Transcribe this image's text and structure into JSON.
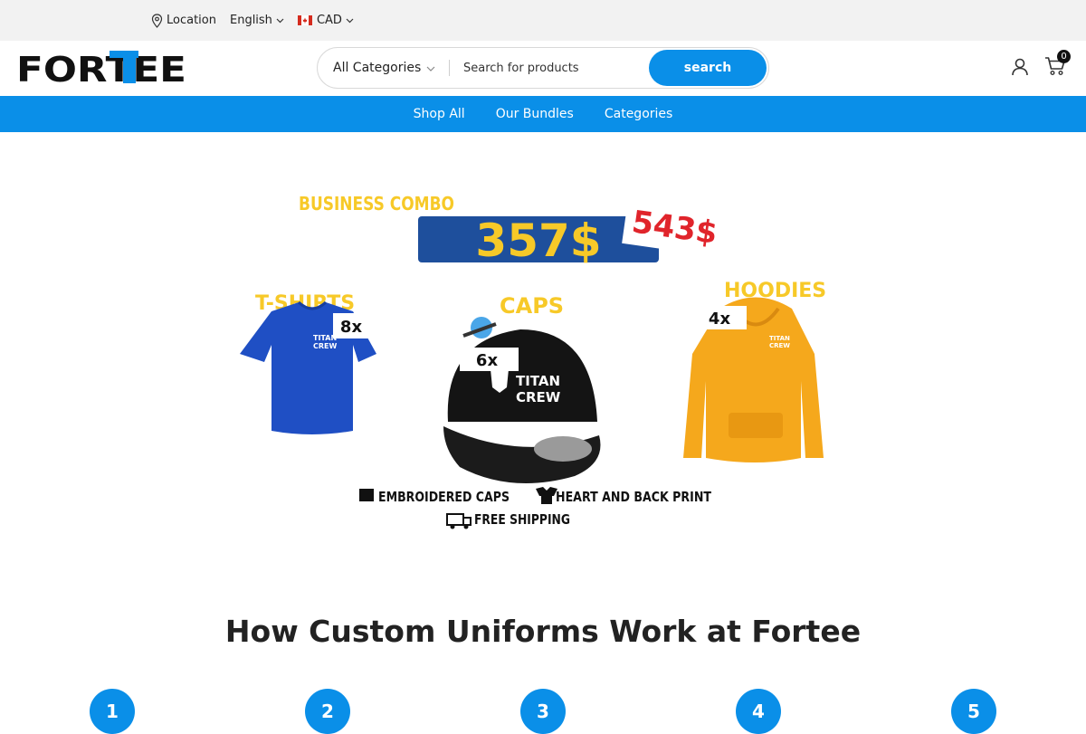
{
  "topbar": {
    "location_label": "Location",
    "language_label": "English",
    "currency_label": "CAD"
  },
  "header": {
    "logo_text": "FORTEE",
    "category_select": "All Categories",
    "search_placeholder": "Search for products",
    "search_button": "search",
    "cart_count": "0"
  },
  "nav": {
    "items": [
      {
        "label": "Shop All"
      },
      {
        "label": "Our Bundles"
      },
      {
        "label": "Categories"
      }
    ]
  },
  "hero": {
    "title": "BUSINESS COMBO",
    "price": "357$",
    "old_price": "543$",
    "products": [
      {
        "name": "T-SHIRTS",
        "qty": "8x",
        "color": "#1f4fc4"
      },
      {
        "name": "CAPS",
        "qty": "6x",
        "color": "#111111"
      },
      {
        "name": "HOODIES",
        "qty": "4x",
        "color": "#f5a81c"
      }
    ],
    "brand_on_product": "TITAN CREW",
    "features": [
      "EMBROIDERED CAPS",
      "HEART AND BACK PRINT",
      "FREE SHIPPING"
    ]
  },
  "how_section": {
    "title": "How Custom Uniforms Work at Fortee",
    "steps": [
      "1",
      "2",
      "3",
      "4",
      "5"
    ]
  },
  "colors": {
    "accent": "#0a8fe8",
    "banner_navy": "#1e4f9c",
    "banner_yellow": "#f7c928",
    "old_price_red": "#e0242b"
  }
}
